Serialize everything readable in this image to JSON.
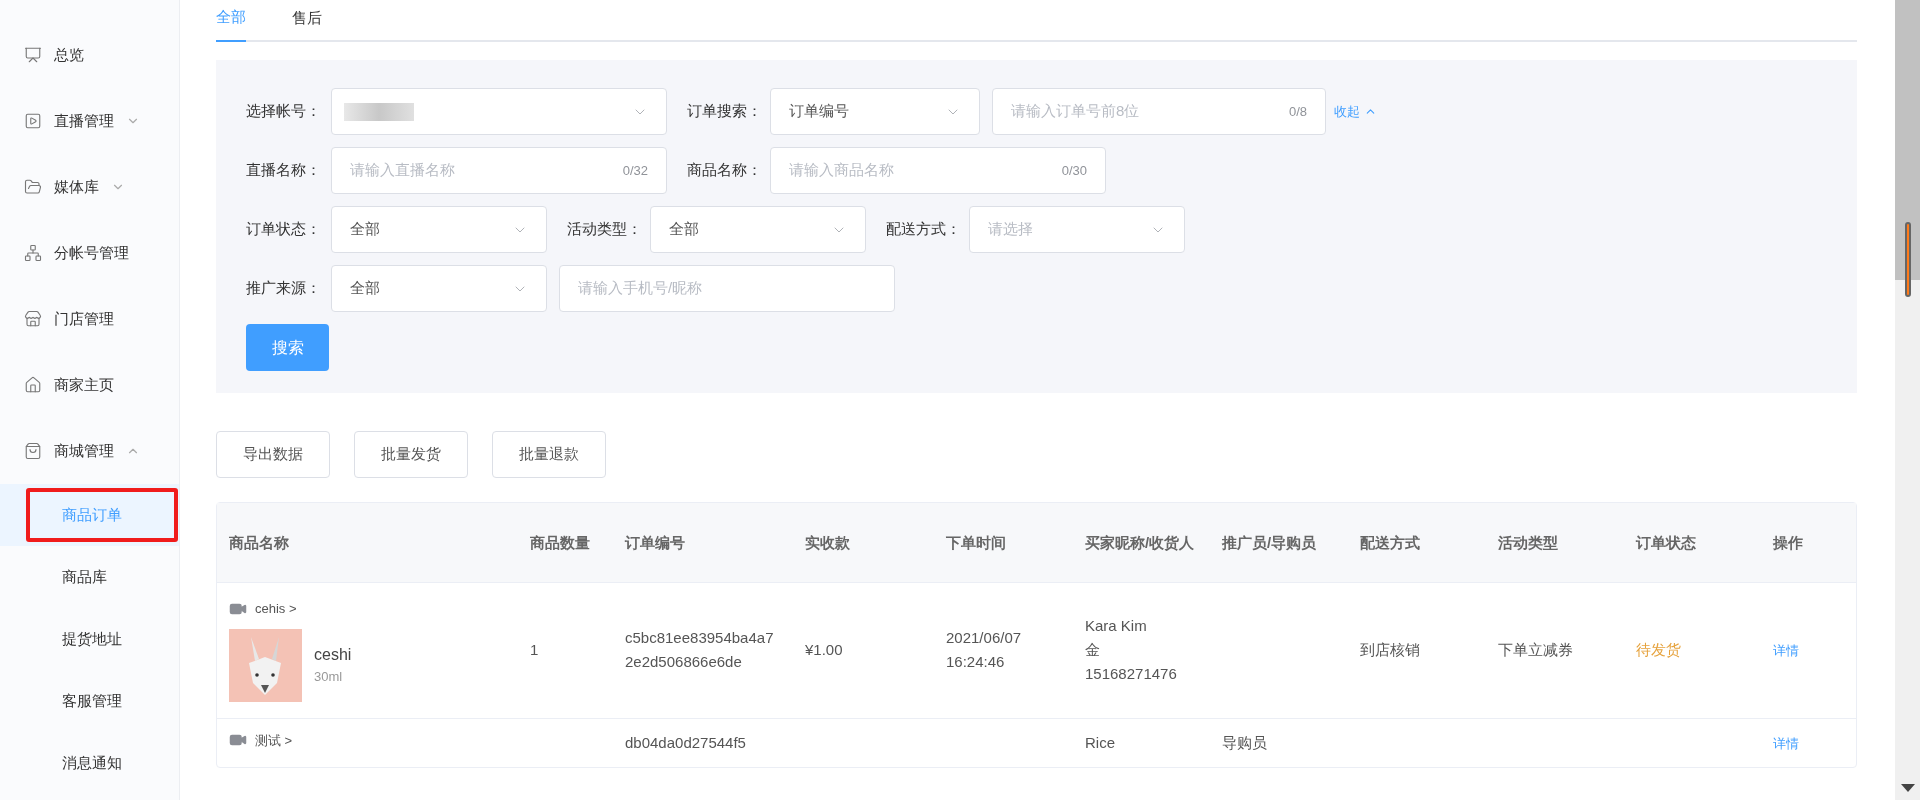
{
  "sidebar": {
    "items": [
      {
        "label": "总览",
        "kind": "link"
      },
      {
        "label": "直播管理",
        "kind": "group",
        "expanded": false
      },
      {
        "label": "媒体库",
        "kind": "group",
        "expanded": false
      },
      {
        "label": "分帐号管理",
        "kind": "link"
      },
      {
        "label": "门店管理",
        "kind": "link"
      },
      {
        "label": "商家主页",
        "kind": "link"
      },
      {
        "label": "商城管理",
        "kind": "group",
        "expanded": true,
        "children": [
          {
            "label": "商品订单",
            "selected": true
          },
          {
            "label": "商品库",
            "selected": false
          },
          {
            "label": "提货地址",
            "selected": false
          },
          {
            "label": "客服管理",
            "selected": false
          },
          {
            "label": "消息通知",
            "selected": false
          }
        ]
      }
    ]
  },
  "tabs": [
    {
      "label": "全部",
      "selected": true
    },
    {
      "label": "售后",
      "selected": false
    }
  ],
  "filters": {
    "rows": [
      [
        {
          "kind": "select",
          "label": "选择帐号：",
          "value_blurred": true
        },
        {
          "kind": "select",
          "label": "订单搜索：",
          "value": "订单编号"
        },
        {
          "kind": "input",
          "placeholder": "请输入订单号前8位",
          "counter": "0/8"
        },
        {
          "kind": "toggle",
          "label": "收起",
          "expanded": true
        }
      ],
      [
        {
          "kind": "input",
          "label": "直播名称：",
          "placeholder": "请输入直播名称",
          "counter": "0/32"
        },
        {
          "kind": "input",
          "label": "商品名称：",
          "placeholder": "请输入商品名称",
          "counter": "0/30"
        }
      ],
      [
        {
          "kind": "select",
          "label": "订单状态：",
          "value": "全部"
        },
        {
          "kind": "select",
          "label": "活动类型：",
          "value": "全部"
        },
        {
          "kind": "select",
          "label": "配送方式：",
          "placeholder": "请选择"
        }
      ],
      [
        {
          "kind": "select",
          "label": "推广来源：",
          "value": "全部"
        },
        {
          "kind": "input",
          "placeholder": "请输入手机号/昵称"
        }
      ]
    ],
    "search_button": "搜索"
  },
  "actions": [
    "导出数据",
    "批量发货",
    "批量退款"
  ],
  "table": {
    "columns": [
      "商品名称",
      "商品数量",
      "订单编号",
      "实收款",
      "下单时间",
      "买家昵称/收货人",
      "推广员/导购员",
      "配送方式",
      "活动类型",
      "订单状态",
      "操作"
    ],
    "rows": [
      {
        "live": "cehis >",
        "product": {
          "name": "ceshi",
          "spec": "30ml"
        },
        "quantity": "1",
        "order_no": "c5bc81ee83954ba4a72e2d506866e6de",
        "amount": "¥1.00",
        "time": [
          "2021/06/07",
          "16:24:46"
        ],
        "buyer": [
          "Kara Kim",
          "金",
          "15168271476"
        ],
        "delivery": "到店核销",
        "activity": "下单立减券",
        "status": {
          "text": "待发货",
          "color": "#e6a23c"
        },
        "action": "详情"
      },
      {
        "live": "测试 >",
        "order_no": "db04da0d27544f5",
        "buyer": [
          "Rice"
        ],
        "promoter": "导购员",
        "action": "详情"
      }
    ]
  }
}
